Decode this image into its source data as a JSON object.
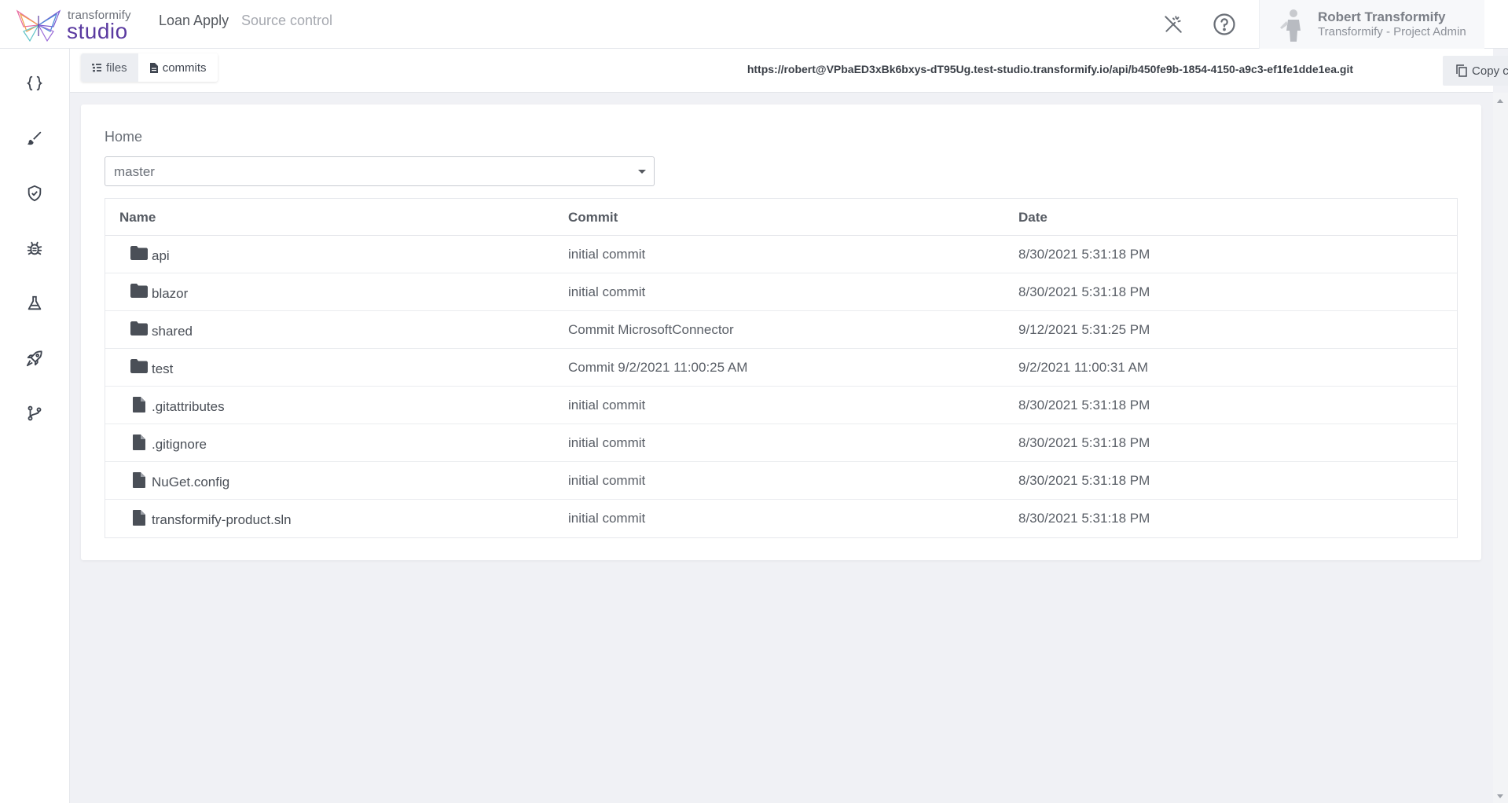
{
  "app": {
    "logo_top": "transformify",
    "logo_bottom": "studio",
    "project": "Loan Apply",
    "page": "Source control"
  },
  "user": {
    "name": "Robert Transformify",
    "role": "Transformify - Project Admin"
  },
  "header_icons": [
    "magic-wand-off-icon",
    "help-icon"
  ],
  "sidebar": {
    "items": [
      {
        "name": "code-braces-icon"
      },
      {
        "name": "brush-icon"
      },
      {
        "name": "shield-check-icon"
      },
      {
        "name": "bug-icon"
      },
      {
        "name": "flask-icon"
      },
      {
        "name": "rocket-icon"
      },
      {
        "name": "source-branch-icon"
      }
    ]
  },
  "tabs": {
    "files": "files",
    "commits": "commits"
  },
  "clone": {
    "url": "https://robert@VPbaED3xBk6bxys-dT95Ug.test-studio.transformify.io/api/b450fe9b-1854-4150-a9c3-ef1fe1dde1ea.git",
    "copy_label": "Copy clone url"
  },
  "main": {
    "home_label": "Home",
    "branch": "master",
    "columns": {
      "name": "Name",
      "commit": "Commit",
      "date": "Date"
    },
    "rows": [
      {
        "type": "folder",
        "name": "api",
        "commit": "initial commit",
        "date": "8/30/2021 5:31:18 PM"
      },
      {
        "type": "folder",
        "name": "blazor",
        "commit": "initial commit",
        "date": "8/30/2021 5:31:18 PM"
      },
      {
        "type": "folder",
        "name": "shared",
        "commit": "Commit MicrosoftConnector",
        "date": "9/12/2021 5:31:25 PM"
      },
      {
        "type": "folder",
        "name": "test",
        "commit": "Commit 9/2/2021 11:00:25 AM",
        "date": "9/2/2021 11:00:31 AM"
      },
      {
        "type": "file",
        "name": ".gitattributes",
        "commit": "initial commit",
        "date": "8/30/2021 5:31:18 PM"
      },
      {
        "type": "file",
        "name": ".gitignore",
        "commit": "initial commit",
        "date": "8/30/2021 5:31:18 PM"
      },
      {
        "type": "file",
        "name": "NuGet.config",
        "commit": "initial commit",
        "date": "8/30/2021 5:31:18 PM"
      },
      {
        "type": "file",
        "name": "transformify-product.sln",
        "commit": "initial commit",
        "date": "8/30/2021 5:31:18 PM"
      }
    ]
  },
  "colors": {
    "brand": "#5a3aa0",
    "background": "#f0f1f5",
    "text": "#4a4f57"
  }
}
